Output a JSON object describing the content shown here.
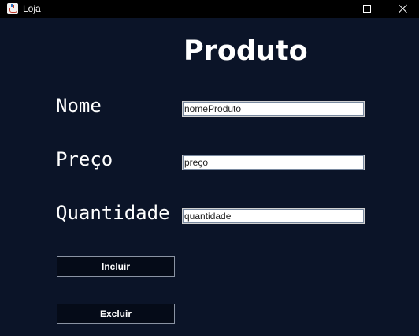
{
  "window": {
    "title": "Loja",
    "icon": "java-cup-icon"
  },
  "form": {
    "heading": "Produto",
    "fields": {
      "nome": {
        "label": "Nome",
        "value": "nomeProduto"
      },
      "preco": {
        "label": "Preço",
        "value": "preço"
      },
      "quantidade": {
        "label": "Quantidade",
        "value": "quantidade"
      }
    },
    "buttons": {
      "incluir": "Incluir",
      "excluir": "Excluir"
    }
  },
  "colors": {
    "background": "#0b1428",
    "titlebar": "#000000",
    "text": "#ffffff",
    "button_background": "#050b18"
  }
}
